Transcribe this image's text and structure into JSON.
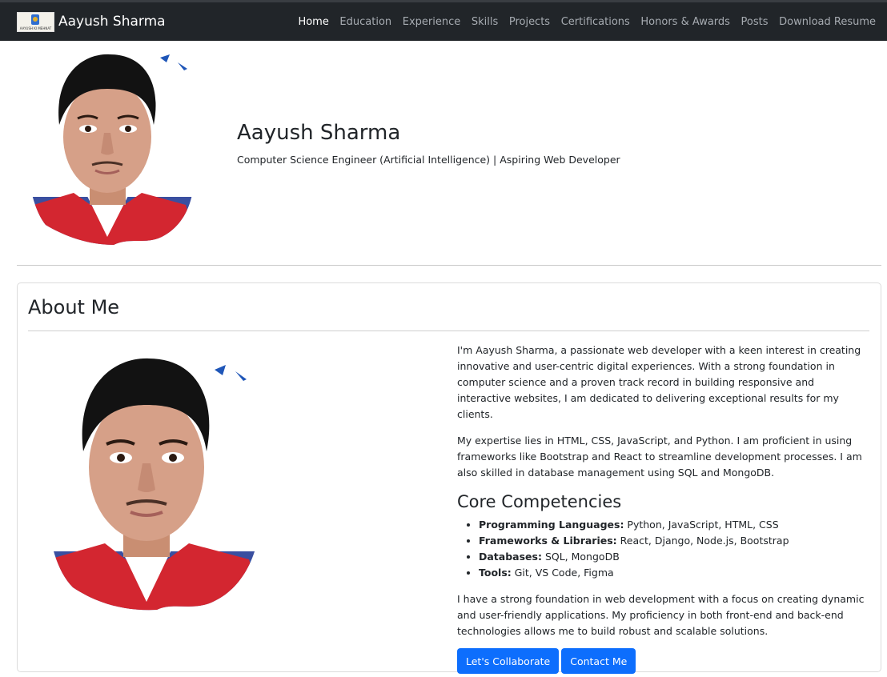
{
  "navbar": {
    "logo_text": "AAYUSH KI MEHNAT",
    "brand": "Aayush Sharma",
    "links": [
      "Home",
      "Education",
      "Experience",
      "Skills",
      "Projects",
      "Certifications",
      "Honors & Awards",
      "Posts",
      "Download Resume"
    ]
  },
  "hero": {
    "name": "Aayush Sharma",
    "subtitle": "Computer Science Engineer (Artificial Intelligence) | Aspiring Web Developer"
  },
  "about": {
    "heading": "About Me",
    "paragraph1": "I'm Aayush Sharma, a passionate web developer with a keen interest in creating innovative and user-centric digital experiences. With a strong foundation in computer science and a proven track record in building responsive and interactive websites, I am dedicated to delivering exceptional results for my clients.",
    "paragraph2": "My expertise lies in HTML, CSS, JavaScript, and Python. I am proficient in using frameworks like Bootstrap and React to streamline development processes. I am also skilled in database management using SQL and MongoDB.",
    "competencies_heading": "Core Competencies",
    "competencies": [
      {
        "label": "Programming Languages:",
        "value": " Python, JavaScript, HTML, CSS"
      },
      {
        "label": "Frameworks & Libraries:",
        "value": " React, Django, Node.js, Bootstrap"
      },
      {
        "label": "Databases:",
        "value": " SQL, MongoDB"
      },
      {
        "label": "Tools:",
        "value": " Git, VS Code, Figma"
      }
    ],
    "paragraph3": "I have a strong foundation in web development with a focus on creating dynamic and user-friendly applications. My proficiency in both front-end and back-end technologies allows me to build robust and scalable solutions.",
    "buttons": {
      "collaborate": "Let's Collaborate",
      "contact": "Contact Me"
    }
  },
  "colors": {
    "navbar": "#212529",
    "primary": "#0d6efd",
    "text": "#212529"
  }
}
